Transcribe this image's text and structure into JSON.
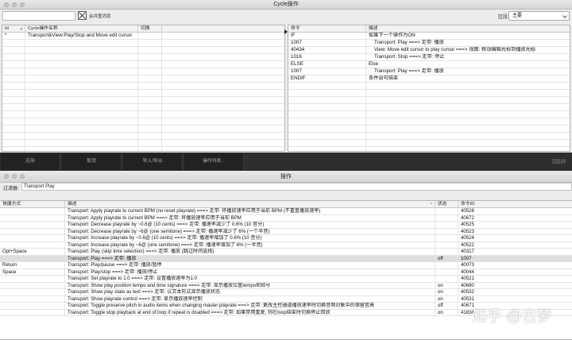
{
  "cycle_window": {
    "title": "Cycle操作",
    "toolbar": {
      "checkbox_label": "会并重消息",
      "section_label": "区段:",
      "section_value": "主要"
    },
    "list_columns": [
      "Id",
      "Cycle操作名称",
      "切换",
      ""
    ],
    "list_rows": [
      {
        "id": "*",
        "name": "Transport&View:Play/Stop and Move edit cursor",
        "toggle": "",
        "extra": ""
      }
    ],
    "step_columns": [
      "命令",
      "描述"
    ],
    "steps": [
      {
        "cmd": "IF",
        "desc": "如果下一个操作为ON",
        "indent": false
      },
      {
        "cmd": "1007",
        "desc": "Transport: Play ===> 走带: 播放",
        "indent": true
      },
      {
        "cmd": "40434",
        "desc": "View: Move edit cursor to play cursor ===> 视图: 移动编辑光标到播放光标",
        "indent": true
      },
      {
        "cmd": "1016",
        "desc": "Transport: Stop ===> 走带: 停止",
        "indent": true
      },
      {
        "cmd": "ELSE",
        "desc": "Else",
        "indent": false
      },
      {
        "cmd": "1007",
        "desc": "Transport: Play ===> 走带: 播放",
        "indent": true
      },
      {
        "cmd": "ENDIF",
        "desc": "条件语句结束",
        "indent": false
      }
    ],
    "buttons": [
      "应用",
      "取消",
      "导入/导出",
      "操作列表..."
    ],
    "logo": "SBM"
  },
  "actions_window": {
    "title": "操作",
    "filter_label": "过滤器:",
    "filter_value": "Transport Play",
    "columns": [
      "快捷方式",
      "描述",
      "状态",
      "命令ID"
    ],
    "rows": [
      {
        "shortcut": "",
        "desc": "Transport: Apply playrate to current BPM (no reset playrate) ===> 走带: 将播放速率应用于当前 BPM (不重置播放速率)",
        "state": "",
        "id": "40526"
      },
      {
        "shortcut": "",
        "desc": "Transport: Apply playrate to current BPM ===> 走带: 将播放速率应用于当前 BPM",
        "state": "",
        "id": "40672"
      },
      {
        "shortcut": "",
        "desc": "Transport: Decrease playrate by ~0.6@ (10 cents) ===> 走带: 播速率减少了 0.6% (10 音分)",
        "state": "",
        "id": "40525"
      },
      {
        "shortcut": "",
        "desc": "Transport: Decrease playrate by ~6@ (one semitone) ===> 走带: 播速率减少了 6% (一个半音)",
        "state": "",
        "id": "40523"
      },
      {
        "shortcut": "",
        "desc": "Transport: Increase playrate by ~0.6@ (10 cents) ===> 走带: 播速率增加了 0.6% (10 音分)",
        "state": "",
        "id": "40524"
      },
      {
        "shortcut": "",
        "desc": "Transport: Increase playrate by ~6@ (one semitone) ===> 走带: 播速率增加了 6% (一半音)",
        "state": "",
        "id": "40522"
      },
      {
        "shortcut": "Opt+Space",
        "desc": "Transport: Play (skip time selection) ===> 走带: 播放 (跳过时间选择)",
        "state": "",
        "id": "40317"
      },
      {
        "shortcut": "",
        "desc": "Transport: Play ===> 走带: 播放",
        "state": "off",
        "id": "1007",
        "selected": true
      },
      {
        "shortcut": "Return",
        "desc": "Transport: Play/pause ===> 走带: 播放/暂停",
        "state": "",
        "id": "40073"
      },
      {
        "shortcut": "Space",
        "desc": "Transport: Play/stop ===> 走带: 播放/停止",
        "state": "",
        "id": "40044"
      },
      {
        "shortcut": "",
        "desc": "Transport: Set playrate to 1.0 ===> 走带: 设置播放速率为1.0",
        "state": "",
        "id": "40521"
      },
      {
        "shortcut": "",
        "desc": "Transport: Show play position tempo and time signature ===> 走带: 显示播放位置tempo和拍号",
        "state": "on",
        "id": "40680"
      },
      {
        "shortcut": "",
        "desc": "Transport: Show play state as text ===> 走带: 以文本形式显示播放状态",
        "state": "on",
        "id": "40532"
      },
      {
        "shortcut": "",
        "desc": "Transport: Show playrate control ===> 走带: 显示播放速率控制",
        "state": "on",
        "id": "40531"
      },
      {
        "shortcut": "",
        "desc": "Transport: Toggle preserve pitch in audio items when changing master playrate ===> 走带: 更改主控通道播放速率时切换音频对象中的保留音高",
        "state": "off",
        "id": "40671"
      },
      {
        "shortcut": "",
        "desc": "Transport: Toggle stop playback at end of loop if repeat is disabled ===> 走带: 如果禁用重复, 则在loop结束时切换停止回放",
        "state": "on",
        "id": "41834"
      }
    ]
  },
  "watermark": "知乎 @古梦"
}
